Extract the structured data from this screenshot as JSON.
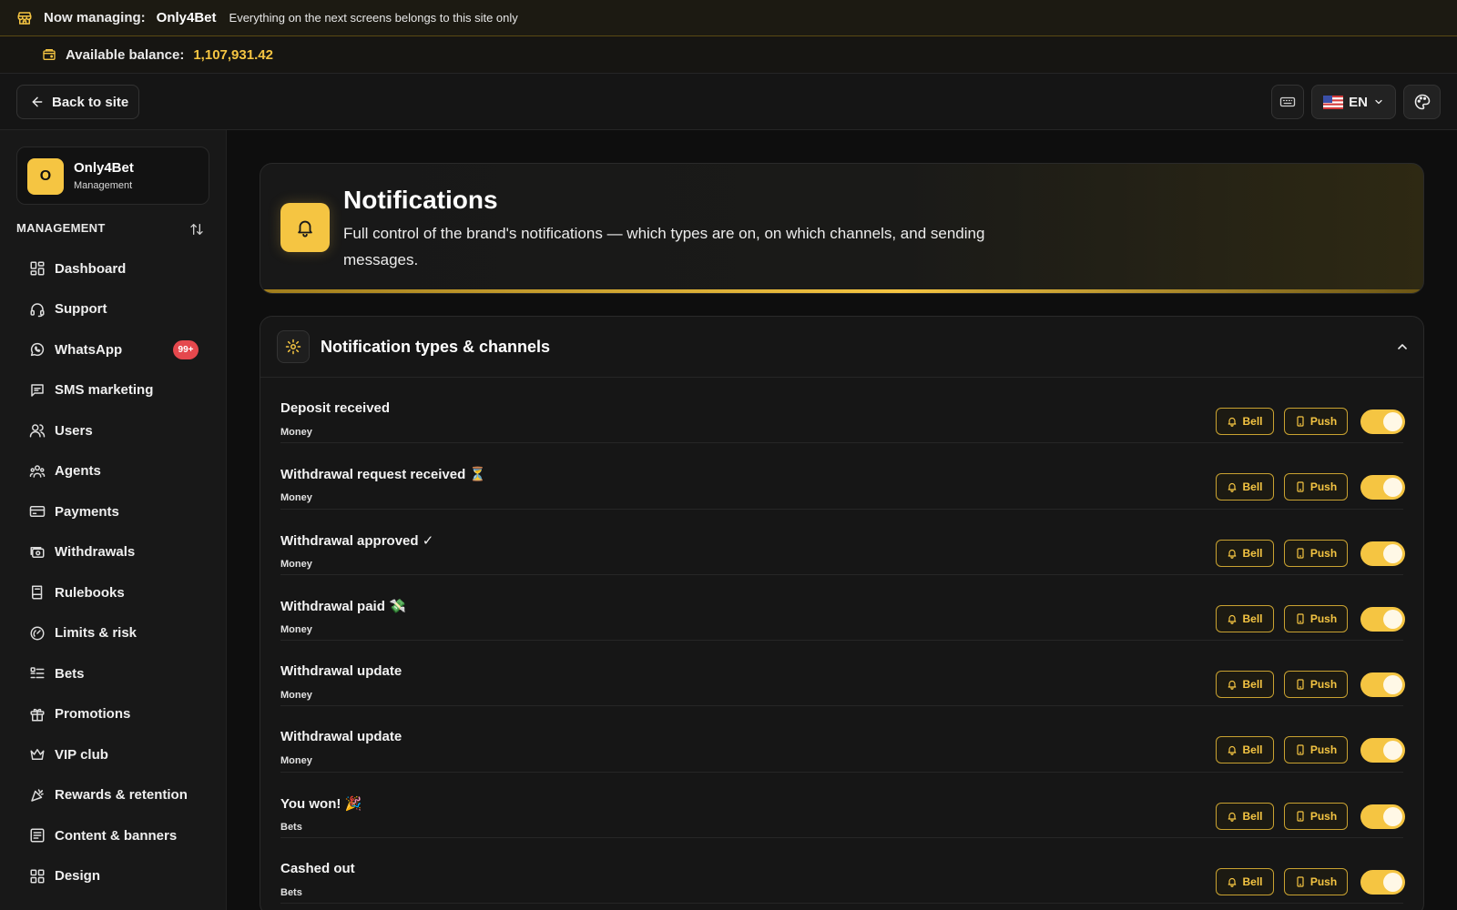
{
  "topbar": {
    "managing_label": "Now managing:",
    "site_name": "Only4Bet",
    "note": "Everything on the next screens belongs to this site only",
    "icon": "store-icon"
  },
  "balance": {
    "label": "Available balance:",
    "amount": "1,107,931.42",
    "icon": "wallet-icon"
  },
  "header": {
    "back_label": "Back to site",
    "language": "EN"
  },
  "sidebar": {
    "brand_initial": "O",
    "brand_name": "Only4Bet",
    "brand_sub": "Management",
    "section_title": "MANAGEMENT",
    "items": [
      {
        "label": "Dashboard",
        "icon": "dashboard-icon"
      },
      {
        "label": "Support",
        "icon": "headset-icon"
      },
      {
        "label": "WhatsApp",
        "icon": "whatsapp-icon",
        "badge": "99+"
      },
      {
        "label": "SMS marketing",
        "icon": "message-icon"
      },
      {
        "label": "Users",
        "icon": "users-icon"
      },
      {
        "label": "Agents",
        "icon": "agents-icon"
      },
      {
        "label": "Payments",
        "icon": "card-icon"
      },
      {
        "label": "Withdrawals",
        "icon": "withdrawals-icon"
      },
      {
        "label": "Rulebooks",
        "icon": "book-icon"
      },
      {
        "label": "Limits & risk",
        "icon": "gauge-icon"
      },
      {
        "label": "Bets",
        "icon": "list-icon"
      },
      {
        "label": "Promotions",
        "icon": "gift-icon"
      },
      {
        "label": "VIP club",
        "icon": "crown-icon"
      },
      {
        "label": "Rewards & retention",
        "icon": "confetti-icon"
      },
      {
        "label": "Content & banners",
        "icon": "content-icon"
      },
      {
        "label": "Design",
        "icon": "grid-icon"
      }
    ]
  },
  "hero": {
    "title": "Notifications",
    "description": "Full control of the brand's notifications — which types are on, on which channels, and sending messages."
  },
  "panel": {
    "title": "Notification types & channels",
    "bell_label": "Bell",
    "push_label": "Push",
    "rows": [
      {
        "title": "Deposit received",
        "category": "Money",
        "enabled": true
      },
      {
        "title": "Withdrawal request received ⏳",
        "category": "Money",
        "enabled": true
      },
      {
        "title": "Withdrawal approved ✓",
        "category": "Money",
        "enabled": true
      },
      {
        "title": "Withdrawal paid 💸",
        "category": "Money",
        "enabled": true
      },
      {
        "title": "Withdrawal update",
        "category": "Money",
        "enabled": true
      },
      {
        "title": "Withdrawal update",
        "category": "Money",
        "enabled": true
      },
      {
        "title": "You won! 🎉",
        "category": "Bets",
        "enabled": true
      },
      {
        "title": "Cashed out",
        "category": "Bets",
        "enabled": true
      }
    ]
  },
  "colors": {
    "accent": "#f5c542",
    "badge": "#e5484d",
    "background": "#0e0e0e"
  }
}
